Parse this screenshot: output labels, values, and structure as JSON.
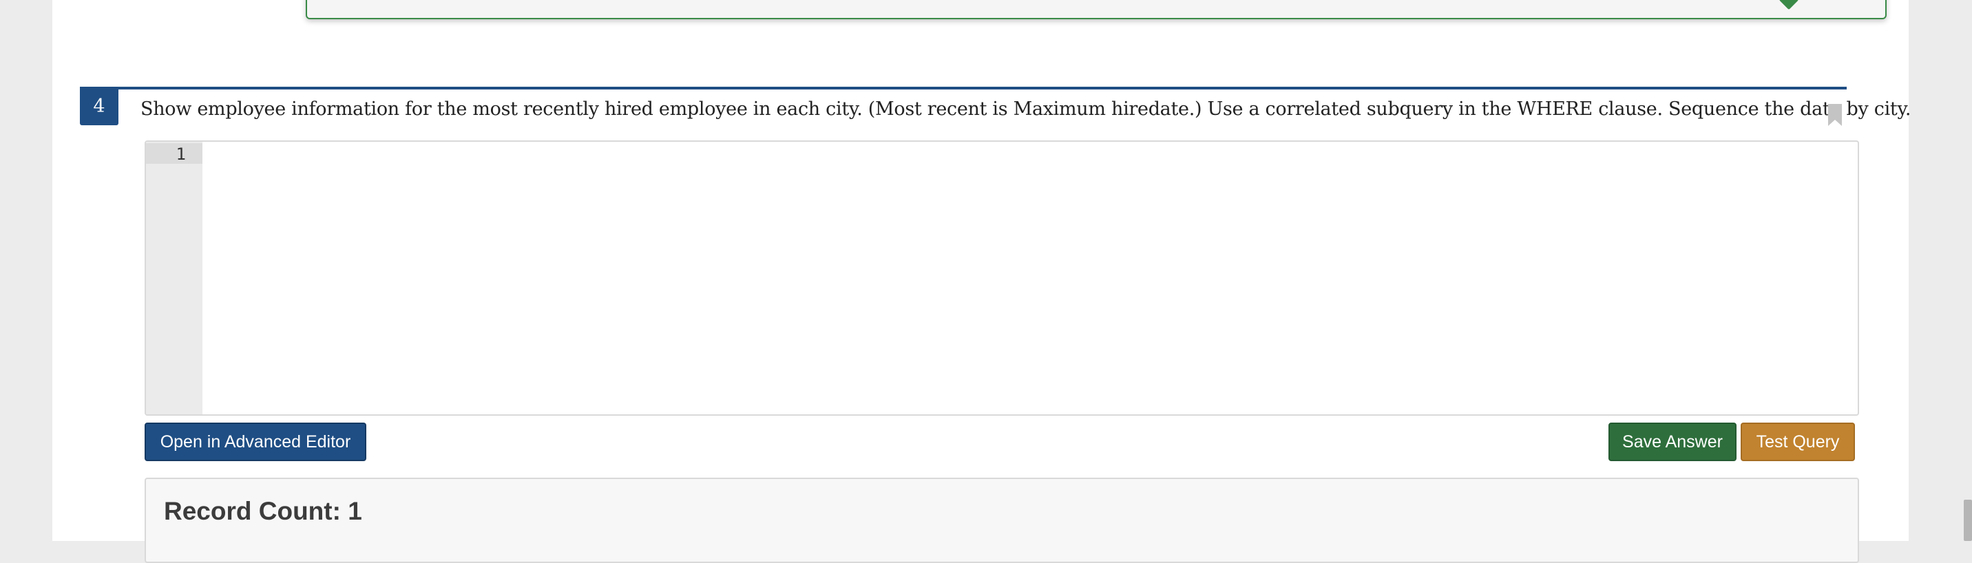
{
  "question": {
    "number": "4",
    "text": "Show employee information for the most recently hired employee in each city. (Most recent is Maximum hiredate.) Use a correlated subquery in the WHERE clause. Sequence the data by city."
  },
  "editor": {
    "line_numbers": [
      "1"
    ],
    "content": ""
  },
  "buttons": {
    "advanced_editor": "Open in Advanced Editor",
    "save_answer": "Save Answer",
    "test_query": "Test Query"
  },
  "result": {
    "record_count": "Record Count: 1"
  },
  "icons": {
    "bookmark": "bookmark-icon",
    "check": "check-icon"
  },
  "colors": {
    "primary": "#1f4e84",
    "success": "#2e6e3c",
    "warning": "#c1832f"
  }
}
